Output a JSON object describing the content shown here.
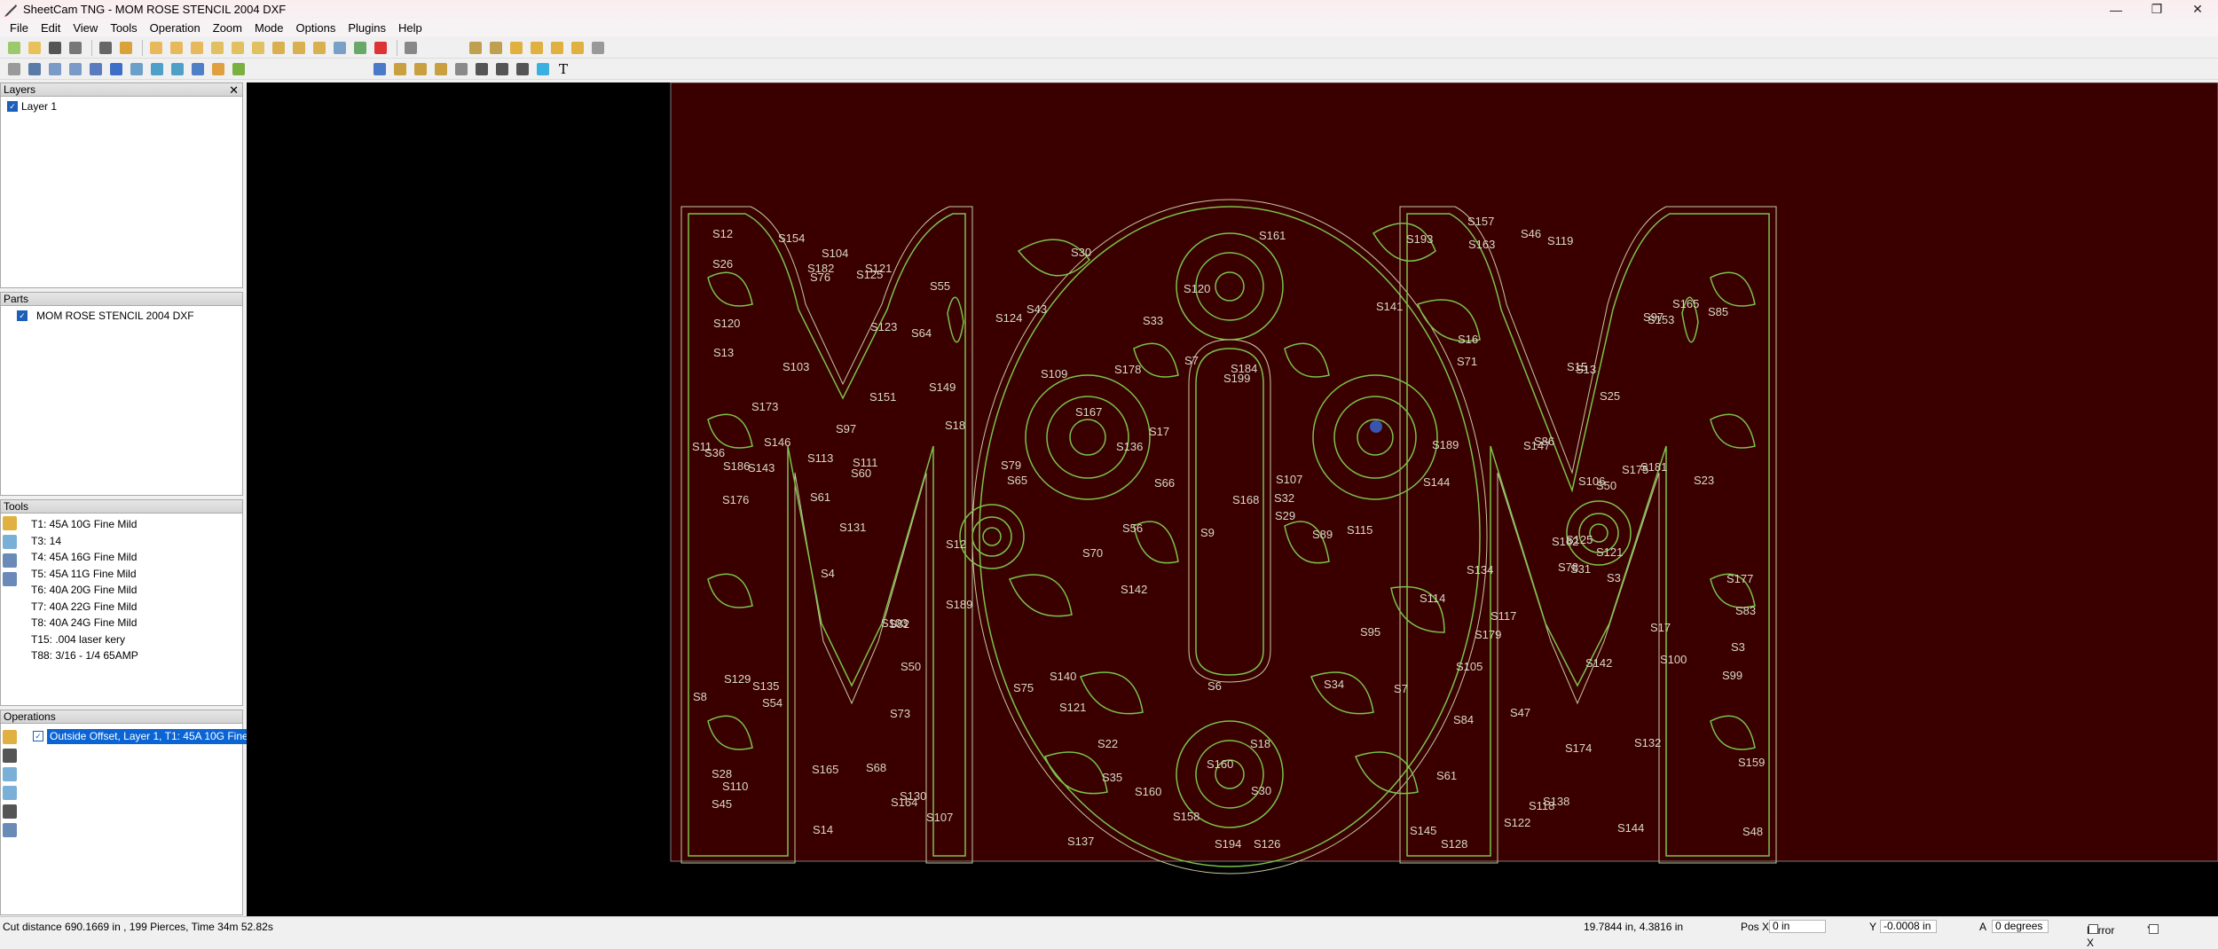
{
  "window": {
    "title": "SheetCam TNG - MOM ROSE STENCIL 2004 DXF"
  },
  "menu": [
    "File",
    "Edit",
    "View",
    "Tools",
    "Operation",
    "Zoom",
    "Mode",
    "Options",
    "Plugins",
    "Help"
  ],
  "layers": {
    "header": "Layers",
    "items": [
      "Layer 1"
    ]
  },
  "parts": {
    "header": "Parts",
    "items": [
      "MOM ROSE STENCIL 2004 DXF"
    ]
  },
  "tools": {
    "header": "Tools",
    "items": [
      "T1: 45A 10G Fine Mild",
      "T3: 14",
      "T4: 45A 16G Fine Mild",
      "T5: 45A 11G Fine Mild",
      "T6: 40A 20G Fine Mild",
      "T7: 40A 22G Fine Mild",
      "T8: 40A 24G Fine Mild",
      "T15: .004 laser kery",
      "T88: 3/16 - 1/4 65AMP"
    ]
  },
  "operations": {
    "header": "Operations",
    "items": [
      "Outside Offset, Layer 1, T1: 45A 10G Fine ..."
    ]
  },
  "status": {
    "cut_info": "Cut distance 690.1669 in , 199 Pierces, Time 34m 52.82s",
    "cursor": "19.7844 in, 4.3816 in",
    "pos_x_label": "Pos X",
    "pos_x": "0 in",
    "y_label": "Y",
    "y": "-0.0008 in",
    "a_label": "A",
    "a": "0 degrees",
    "mirror_x": "Mirror X",
    "mirror_y": "Y"
  },
  "canvas": {
    "sheet_color": "#3a0000",
    "part_outline_color": "#7cc24a",
    "offset_color": "#c8c8a0",
    "labels": [
      "S4",
      "S109",
      "S125",
      "S28",
      "S107",
      "S47",
      "S121",
      "S184",
      "S153",
      "S131",
      "S30",
      "S48",
      "S176",
      "S16",
      "S78",
      "S151",
      "S137",
      "S15",
      "S97",
      "S121",
      "S86",
      "S45",
      "S35",
      "S13",
      "S60",
      "S95",
      "S71",
      "S76",
      "S65",
      "S17",
      "S18",
      "S9",
      "S174",
      "S61",
      "S178",
      "S165",
      "S54",
      "S145",
      "S159",
      "S82",
      "S161",
      "S147",
      "S143",
      "S34",
      "S122",
      "S11",
      "S32",
      "S128",
      "S165",
      "S29",
      "S84",
      "S149",
      "S124",
      "S100",
      "S68",
      "S22",
      "S163",
      "S12",
      "S18",
      "S85",
      "S104",
      "S56",
      "S189",
      "S173",
      "S141",
      "S157",
      "S125",
      "S120",
      "S106",
      "S8",
      "S6",
      "S118",
      "S103",
      "S136",
      "S61",
      "S26",
      "S167",
      "S114",
      "S113",
      "S30",
      "S50",
      "S110",
      "S89",
      "S3",
      "S14",
      "S144",
      "S142",
      "S130",
      "S126",
      "S132",
      "S182",
      "S134",
      "S181",
      "S73",
      "S168",
      "S99",
      "S36",
      "S194",
      "S97",
      "S123",
      "S70",
      "S46",
      "S12",
      "S79",
      "S179",
      "S135",
      "S160",
      "S175",
      "S64",
      "S66",
      "S177",
      "S120",
      "S199",
      "S162",
      "S154",
      "S75",
      "S31",
      "S55",
      "S7",
      "S119",
      "S129",
      "S193",
      "S25",
      "S103",
      "S115",
      "S117",
      "S107",
      "S158",
      "S23",
      "S13",
      "S140",
      "S144",
      "S146",
      "S33",
      "S83",
      "S50",
      "S142",
      "S105",
      "S189",
      "S17",
      "S3",
      "S186",
      "S7",
      "S121",
      "S111",
      "S43",
      "S138",
      "S164",
      "S160"
    ]
  }
}
